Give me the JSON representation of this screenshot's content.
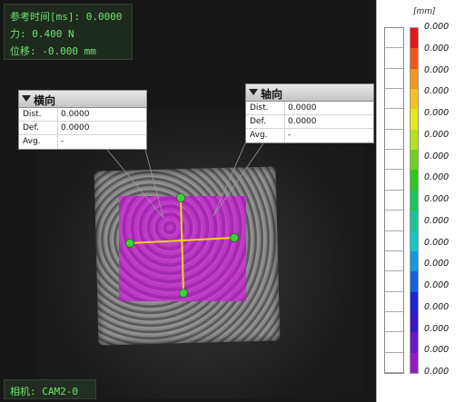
{
  "overlay": {
    "time_label": "参考时间[ms]: 0.0000",
    "force_label": "力: 0.400 N",
    "displacement_label": "位移: -0.000 mm"
  },
  "camera": {
    "label": "相机: CAM2-0"
  },
  "callout_left": {
    "title": "横向",
    "rows": [
      {
        "label": "Dist.",
        "value": "0.0000"
      },
      {
        "label": "Def.",
        "value": "0.0000"
      },
      {
        "label": "Avg.",
        "value": "-"
      }
    ]
  },
  "callout_right": {
    "title": "轴向",
    "rows": [
      {
        "label": "Dist.",
        "value": "0.0000"
      },
      {
        "label": "Def.",
        "value": "0.0000"
      },
      {
        "label": "Avg.",
        "value": "-"
      }
    ]
  },
  "colors": {
    "roi": "#b830c2",
    "crosshair_line": "#f2d21a",
    "marker": "#3ad43a",
    "overlay_text": "#6de86d"
  },
  "scale": {
    "unit": "[mm]",
    "ticks": [
      "0.000",
      "0.000",
      "0.000",
      "0.000",
      "0.000",
      "0.000",
      "0.000",
      "0.000",
      "0.000",
      "0.000",
      "0.000",
      "0.000",
      "0.000",
      "0.000",
      "0.000",
      "0.000",
      "0.000"
    ],
    "colors": [
      "#e8141c",
      "#f0561c",
      "#f7941c",
      "#f6c21a",
      "#e8e51a",
      "#b5e31a",
      "#6ed21e",
      "#2ec81e",
      "#18c65a",
      "#14c896",
      "#12c8c8",
      "#1298e0",
      "#1260e0",
      "#1a26d8",
      "#3a18c8",
      "#6a18c8",
      "#9818c8"
    ]
  }
}
